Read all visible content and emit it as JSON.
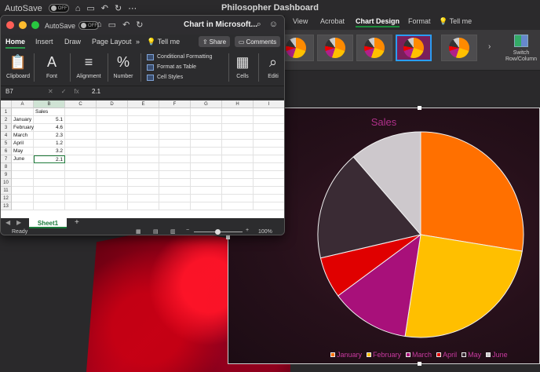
{
  "back_window": {
    "autosave_label": "AutoSave",
    "autosave_state": "OFF",
    "title": "Philosopher Dashboard",
    "tabs": [
      "View",
      "Acrobat",
      "Chart Design",
      "Format",
      "Tell me"
    ],
    "active_tab": "Chart Design",
    "switch_label_1": "Switch",
    "switch_label_2": "Row/Column"
  },
  "front_window": {
    "autosave_label": "AutoSave",
    "autosave_state": "OFF",
    "title": "Chart in Microsoft...",
    "tabs": [
      "Home",
      "Insert",
      "Draw",
      "Page Layout",
      "Tell me"
    ],
    "active_tab": "Home",
    "share_label": "Share",
    "comments_label": "Comments",
    "ribbon": {
      "clipboard": "Clipboard",
      "font": "Font",
      "alignment": "Alignment",
      "number": "Number",
      "conditional": "Conditional Formatting",
      "format_table": "Format as Table",
      "cell_styles": "Cell Styles",
      "cells": "Cells",
      "editing": "Editi"
    },
    "formula_bar": {
      "name_box": "B7",
      "fx": "fx",
      "value": "2.1"
    },
    "columns": [
      "A",
      "B",
      "C",
      "D",
      "E",
      "F",
      "G",
      "H",
      "I"
    ],
    "rows": [
      "1",
      "2",
      "3",
      "4",
      "5",
      "6",
      "7",
      "8",
      "9",
      "10",
      "11",
      "12",
      "13"
    ],
    "cells": {
      "B1": "Sales",
      "A2": "January",
      "B2": "5.1",
      "A3": "February",
      "B3": "4.6",
      "A4": "March",
      "B4": "2.3",
      "A5": "April",
      "B5": "1.2",
      "A6": "May",
      "B6": "3.2",
      "A7": "June",
      "B7": "2.1"
    },
    "sheet_tab": "Sheet1",
    "status": "Ready",
    "zoom": "100%"
  },
  "chart_data": {
    "type": "pie",
    "title": "Sales",
    "categories": [
      "January",
      "February",
      "March",
      "April",
      "May",
      "June"
    ],
    "values": [
      5.1,
      4.6,
      2.3,
      1.2,
      3.2,
      2.1
    ],
    "colors": [
      "#ff7000",
      "#ffbf00",
      "#a8107a",
      "#e00000",
      "#3a2b34",
      "#cdc8cc"
    ],
    "legend_position": "bottom"
  }
}
